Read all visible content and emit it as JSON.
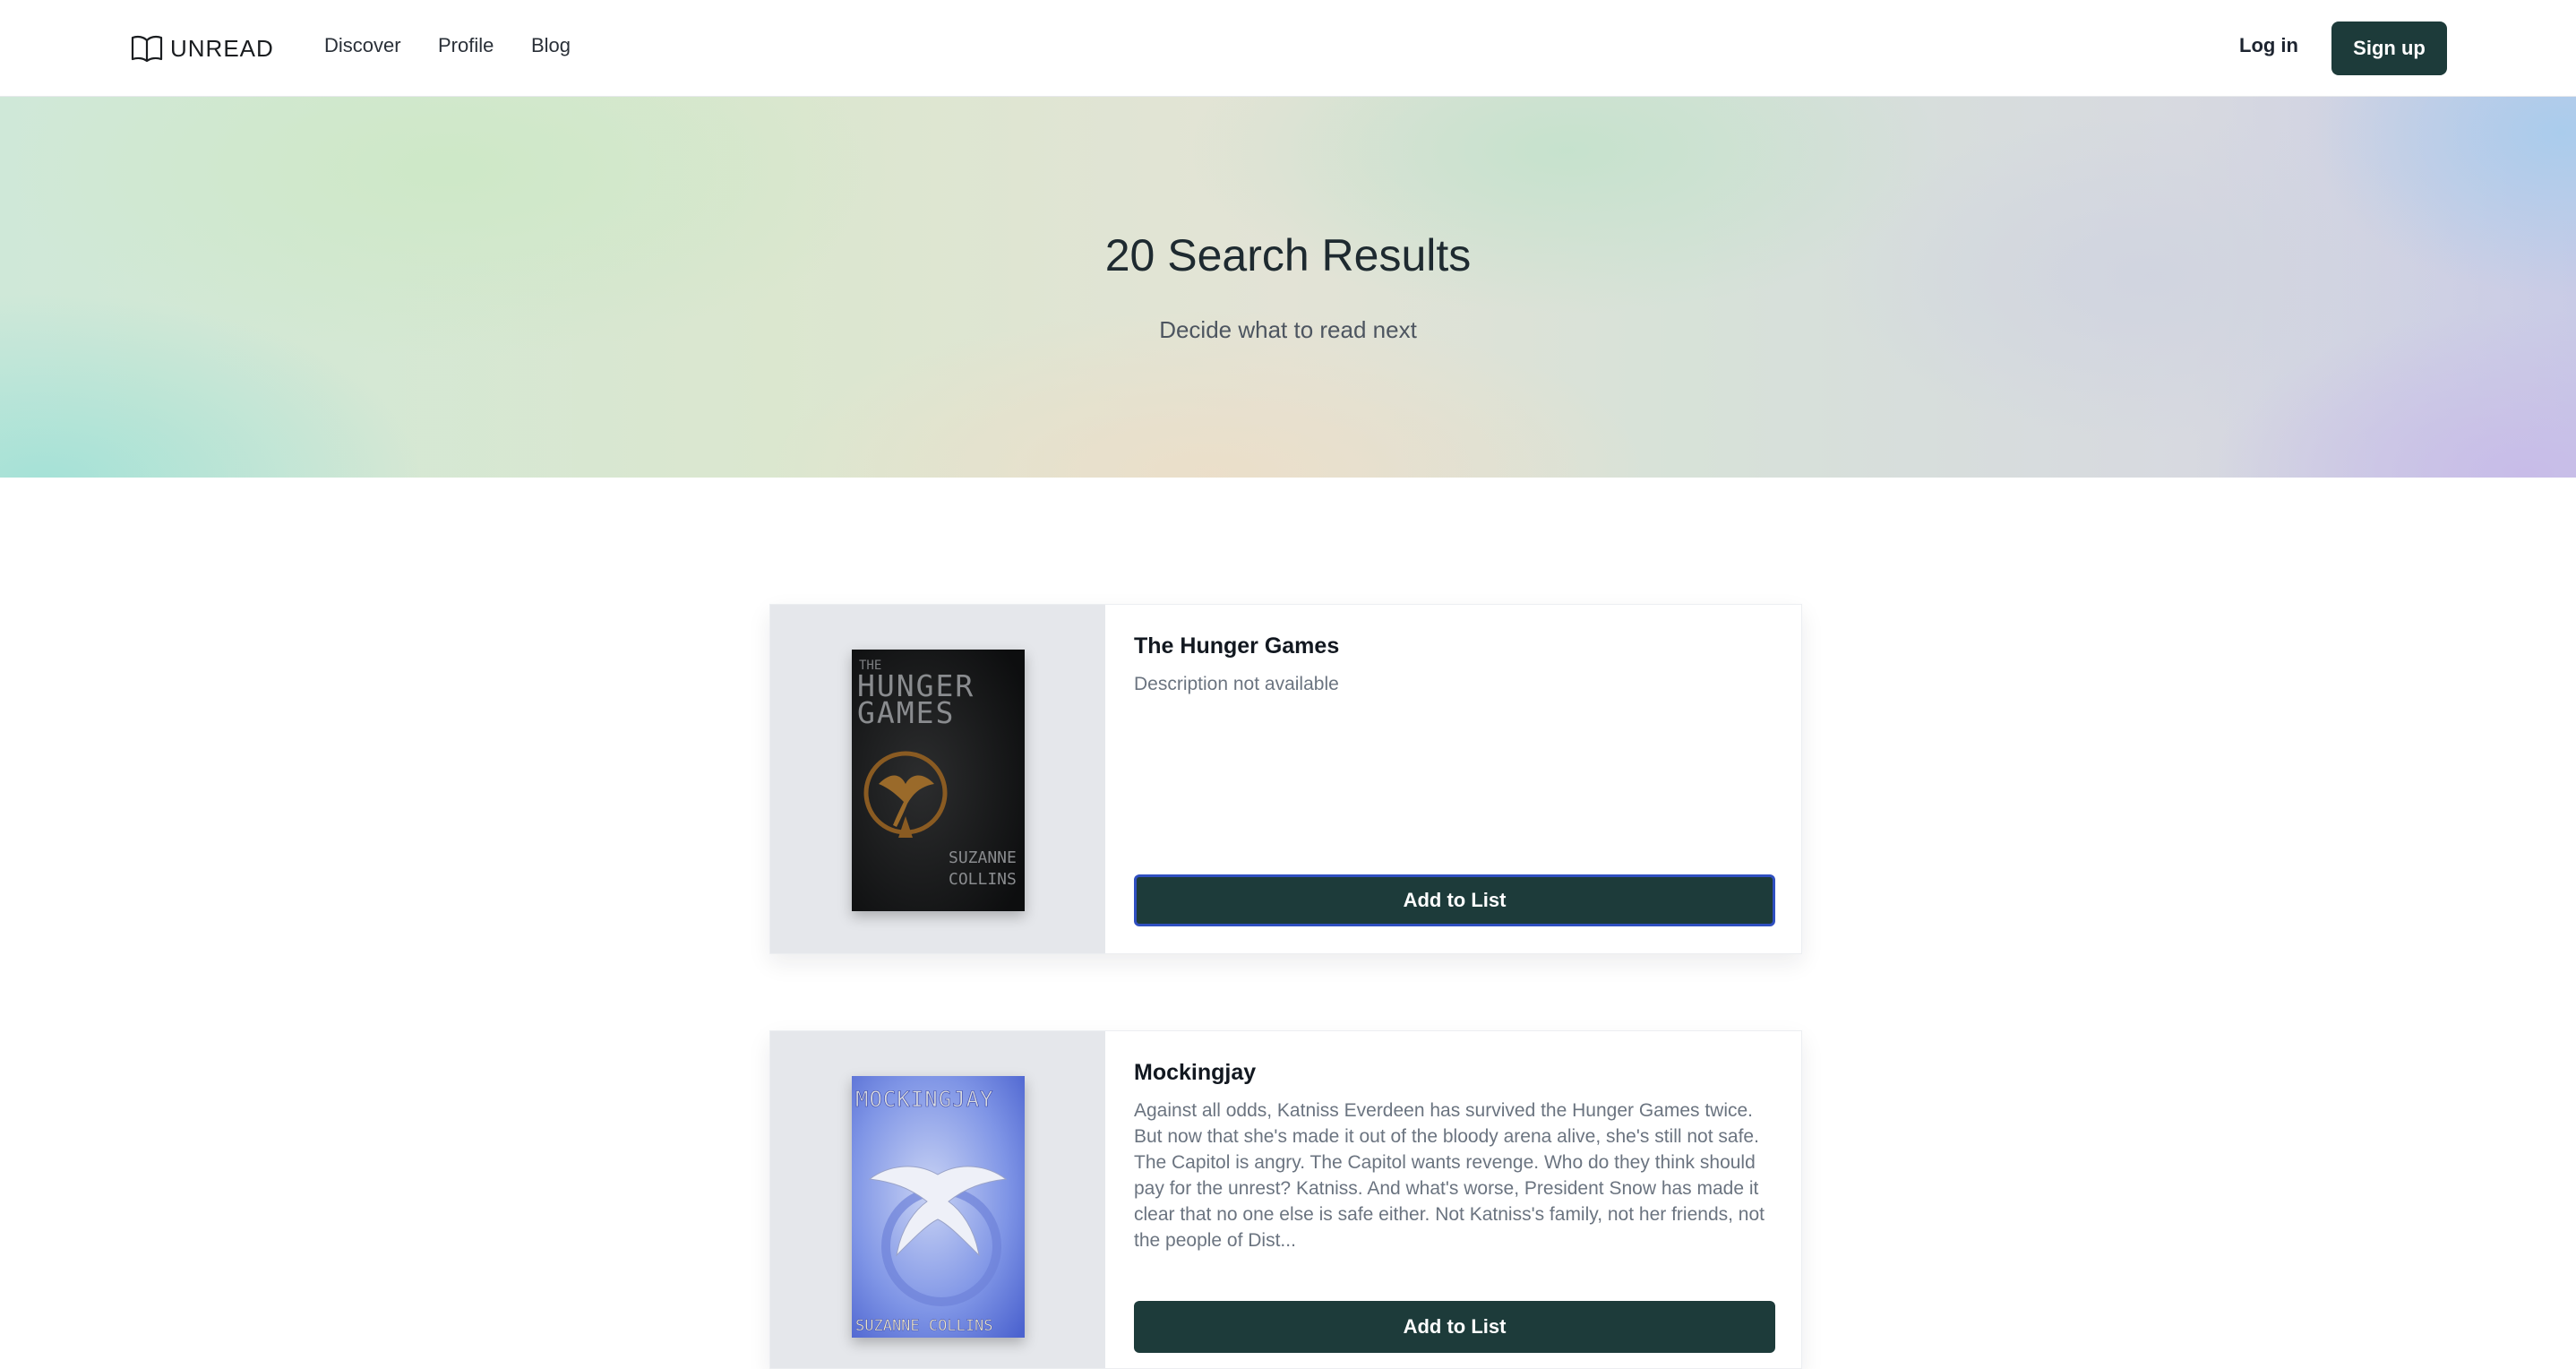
{
  "nav": {
    "logo_text": "UNREAD",
    "links": [
      "Discover",
      "Profile",
      "Blog"
    ],
    "login_label": "Log in",
    "signup_label": "Sign up"
  },
  "hero": {
    "title": "20 Search Results",
    "subtitle": "Decide what to read next"
  },
  "results": [
    {
      "title": "The Hunger Games",
      "description": "Description not available",
      "button_label": "Add to List",
      "cover": {
        "title_line1": "THE",
        "title_line2": "HUNGER",
        "title_line3": "GAMES",
        "author_line1": "SUZANNE",
        "author_line2": "COLLINS"
      }
    },
    {
      "title": "Mockingjay",
      "description": "Against all odds, Katniss Everdeen has survived the Hunger Games twice. But now that she's made it out of the bloody arena alive, she's still not safe. The Capitol is angry. The Capitol wants revenge. Who do they think should pay for the unrest? Katniss. And what's worse, President Snow has made it clear that no one else is safe either. Not Katniss's family, not her friends, not the people of Dist...",
      "button_label": "Add to List",
      "cover": {
        "title": "MOCKINGJAY",
        "author": "SUZANNE COLLINS"
      }
    }
  ],
  "colors": {
    "primary": "#1d3b3a",
    "focus_ring": "#2f4fc0"
  }
}
